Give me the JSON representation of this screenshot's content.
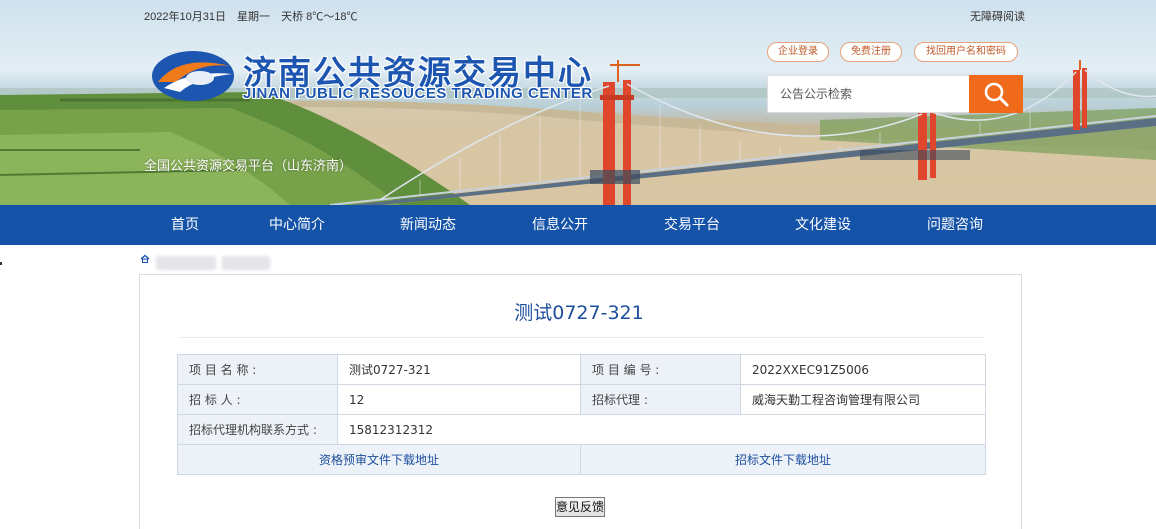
{
  "topbar": {
    "date": "2022年10月31日",
    "weekday": "星期一",
    "weather": "天桥 8℃～18℃",
    "accessibility": "无障碍阅读"
  },
  "brand": {
    "name_cn": "济南公共资源交易中心",
    "name_en": "JINAN PUBLIC RESOUCES TRADING CENTER",
    "platform": "全国公共资源交易平台（山东济南）"
  },
  "account_links": {
    "login": "企业登录",
    "register": "免费注册",
    "recover": "找回用户名和密码"
  },
  "search": {
    "placeholder": "公告公示检索",
    "icon": "search-icon"
  },
  "nav": {
    "items": [
      "首页",
      "中心简介",
      "新闻动态",
      "信息公开",
      "交易平台",
      "文化建设",
      "问题咨询"
    ]
  },
  "breadcrumb": {
    "icon": "home-icon"
  },
  "detail": {
    "title": "测试0727-321",
    "rows": {
      "project_name_label": "项 目 名 称 :",
      "project_name_value": "测试0727-321",
      "project_no_label": "项 目 编 号 :",
      "project_no_value": "2022XXEC91Z5006",
      "tenderer_label": "招 标 人 :",
      "tenderer_value": "12",
      "agent_label": "招标代理 :",
      "agent_value": "威海天勤工程咨询管理有限公司",
      "contact_label": "招标代理机构联系方式 :",
      "contact_value": "15812312312"
    },
    "links": {
      "prequal_download": "资格预审文件下载地址",
      "tender_download": "招标文件下载地址"
    }
  },
  "feedback_button": "意见反馈",
  "colors": {
    "nav_bg": "#1553a8",
    "brand_blue": "#1d56b1",
    "search_btn": "#f06a1c",
    "title_blue": "#1d4f9c",
    "table_label_bg": "#edf2f8"
  }
}
